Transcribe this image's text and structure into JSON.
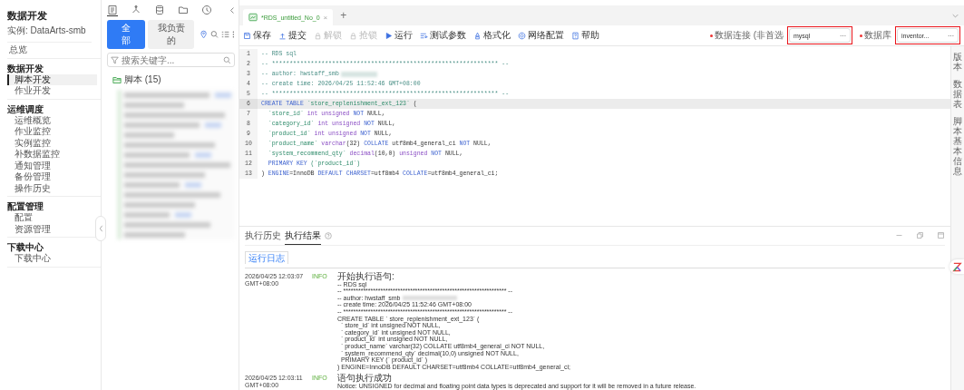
{
  "nav": {
    "title": "数据开发",
    "instance": "实例: DataArts-smb",
    "sections": [
      {
        "items": [
          {
            "label": "总览",
            "selected": false
          }
        ]
      },
      {
        "heading": "数据开发",
        "items": [
          {
            "label": "脚本开发",
            "selected": true
          },
          {
            "label": "作业开发",
            "selected": false
          }
        ]
      },
      {
        "heading": "运维调度",
        "items": [
          {
            "label": "运维概览",
            "selected": false
          },
          {
            "label": "作业监控",
            "selected": false
          },
          {
            "label": "实例监控",
            "selected": false
          },
          {
            "label": "补数据监控",
            "selected": false
          },
          {
            "label": "通知管理",
            "selected": false
          },
          {
            "label": "备份管理",
            "selected": false
          },
          {
            "label": "操作历史",
            "selected": false
          }
        ]
      },
      {
        "heading": "配置管理",
        "items": [
          {
            "label": "配置",
            "selected": false
          },
          {
            "label": "资源管理",
            "selected": false
          }
        ]
      },
      {
        "heading": "下载中心",
        "items": [
          {
            "label": "下载中心",
            "selected": false
          }
        ]
      }
    ]
  },
  "files": {
    "filters": [
      {
        "label": "全部",
        "selected": true
      },
      {
        "label": "我负责的",
        "selected": false
      }
    ],
    "search": {
      "placeholder": "搜索关键字..."
    },
    "tree": {
      "label": "脚本 (15)",
      "expanded": true
    }
  },
  "editor_tab": {
    "label": "*RDS_untitled_No_0",
    "close": "×",
    "add": "+"
  },
  "toolbar": [
    {
      "label": "保存",
      "disabled": false
    },
    {
      "label": "提交",
      "disabled": false
    },
    {
      "label": "解锁",
      "disabled": true
    },
    {
      "label": "抢锁",
      "disabled": true
    },
    {
      "label": "运行",
      "disabled": false
    },
    {
      "label": "测试参数",
      "disabled": false
    },
    {
      "label": "格式化",
      "disabled": false
    },
    {
      "label": "网络配置",
      "disabled": false
    },
    {
      "label": "帮助",
      "disabled": false
    }
  ],
  "selectors": [
    {
      "label": "数据连接 (非首选",
      "value": "mysql",
      "more": "···",
      "highlighted": true
    },
    {
      "label": "数据库",
      "value": "inventor...",
      "more": "···",
      "highlighted": true
    }
  ],
  "code": [
    {
      "no": "1",
      "current": false,
      "tokens": [
        {
          "text": "-- RDS sql",
          "kind": "comment"
        }
      ]
    },
    {
      "no": "2",
      "current": false,
      "tokens": [
        {
          "text": "-- **************************************************************** --",
          "kind": "comment"
        }
      ]
    },
    {
      "no": "3",
      "current": false,
      "blurred": true,
      "tokens": [
        {
          "text": "-- author: hwstaff_smb",
          "kind": "comment"
        }
      ]
    },
    {
      "no": "4",
      "current": false,
      "tokens": [
        {
          "text": "-- create time: 2026/04/25 11:52:46 GMT+08:00",
          "kind": "comment"
        }
      ]
    },
    {
      "no": "5",
      "current": false,
      "tokens": [
        {
          "text": "-- **************************************************************** --",
          "kind": "comment"
        }
      ]
    },
    {
      "no": "6",
      "current": true,
      "tokens": [
        {
          "text": "CREATE TABLE ",
          "kind": "keyword"
        },
        {
          "text": "`store_replenishment_ext_123`",
          "kind": "ident"
        },
        {
          "text": " (",
          "kind": "plain"
        }
      ]
    },
    {
      "no": "7",
      "current": false,
      "tokens": [
        {
          "text": "  `store_id`",
          "kind": "ident"
        },
        {
          "text": " int unsigned ",
          "kind": "type"
        },
        {
          "text": "NOT",
          "kind": "keyword"
        },
        {
          "text": " NULL,",
          "kind": "plain"
        }
      ]
    },
    {
      "no": "8",
      "current": false,
      "tokens": [
        {
          "text": "  `category_id`",
          "kind": "ident"
        },
        {
          "text": " int unsigned ",
          "kind": "type"
        },
        {
          "text": "NOT",
          "kind": "keyword"
        },
        {
          "text": " NULL,",
          "kind": "plain"
        }
      ]
    },
    {
      "no": "9",
      "current": false,
      "tokens": [
        {
          "text": "  `product_id`",
          "kind": "ident"
        },
        {
          "text": " int unsigned ",
          "kind": "type"
        },
        {
          "text": "NOT",
          "kind": "keyword"
        },
        {
          "text": " NULL,",
          "kind": "plain"
        }
      ]
    },
    {
      "no": "10",
      "current": false,
      "tokens": [
        {
          "text": "  `product_name`",
          "kind": "ident"
        },
        {
          "text": " varchar",
          "kind": "type"
        },
        {
          "text": "(32) ",
          "kind": "plain"
        },
        {
          "text": "COLLATE",
          "kind": "keyword"
        },
        {
          "text": " utf8mb4_general_ci ",
          "kind": "plain"
        },
        {
          "text": "NOT",
          "kind": "keyword"
        },
        {
          "text": " NULL,",
          "kind": "plain"
        }
      ]
    },
    {
      "no": "11",
      "current": false,
      "tokens": [
        {
          "text": "  `system_recommend_qty`",
          "kind": "ident"
        },
        {
          "text": " decimal",
          "kind": "type"
        },
        {
          "text": "(10,0) ",
          "kind": "plain"
        },
        {
          "text": "unsigned",
          "kind": "type"
        },
        {
          "text": " NOT",
          "kind": "keyword"
        },
        {
          "text": " NULL,",
          "kind": "plain"
        }
      ]
    },
    {
      "no": "12",
      "current": false,
      "tokens": [
        {
          "text": "  PRIMARY KEY ",
          "kind": "keyword"
        },
        {
          "text": "(`product_id`)",
          "kind": "ident"
        }
      ]
    },
    {
      "no": "13",
      "current": false,
      "tokens": [
        {
          "text": ") ",
          "kind": "plain"
        },
        {
          "text": "ENGINE",
          "kind": "keyword"
        },
        {
          "text": "=InnoDB ",
          "kind": "plain"
        },
        {
          "text": "DEFAULT CHARSET",
          "kind": "keyword"
        },
        {
          "text": "=utf8mb4 ",
          "kind": "plain"
        },
        {
          "text": "COLLATE",
          "kind": "keyword"
        },
        {
          "text": "=utf8mb4_general_ci;",
          "kind": "plain"
        }
      ]
    }
  ],
  "side_tabs": [
    "版本",
    "数据表",
    "脚本基本信息"
  ],
  "results": {
    "tabs": [
      {
        "label": "执行历史",
        "selected": false
      },
      {
        "label": "执行结果",
        "selected": true
      }
    ],
    "subtab": "运行日志",
    "entries": [
      {
        "time": "2026/04/25 12:03:07",
        "zone": "GMT+08:00",
        "level": "INFO",
        "title": "开始执行语句:",
        "lines": [
          {
            "text": "-- RDS sql"
          },
          {
            "text": "-- ****************************************************************** --"
          },
          {
            "text": "-- author: hwstaff_smb",
            "blurred": true
          },
          {
            "text": "-- create time: 2026/04/25 11:52:46 GMT+08:00"
          },
          {
            "text": "-- ****************************************************************** --"
          },
          {
            "text": "CREATE TABLE ` store_replenishment_ext_123` ("
          },
          {
            "text": "  ` store_id` int unsigned NOT NULL,"
          },
          {
            "text": "  ` category_id` int unsigned NOT NULL,"
          },
          {
            "text": "  ` product_id` int unsigned NOT NULL,"
          },
          {
            "text": "  ` product_name` varchar(32) COLLATE utf8mb4_general_ci NOT NULL,"
          },
          {
            "text": "  ` system_recommend_qty` decimal(10,0) unsigned NOT NULL,"
          },
          {
            "text": "  PRIMARY KEY (` product_id` )"
          },
          {
            "text": ") ENGINE=InnoDB DEFAULT CHARSET=utf8mb4 COLLATE=utf8mb4_general_ci;"
          }
        ]
      },
      {
        "time": "2026/04/25 12:03:11",
        "zone": "GMT+08:00",
        "level": "INFO",
        "title": "语句执行成功",
        "lines": [
          {
            "text": "Notice: UNSIGNED for decimal and floating point data types is deprecated and support for it will be removed in a future release."
          }
        ]
      }
    ]
  }
}
